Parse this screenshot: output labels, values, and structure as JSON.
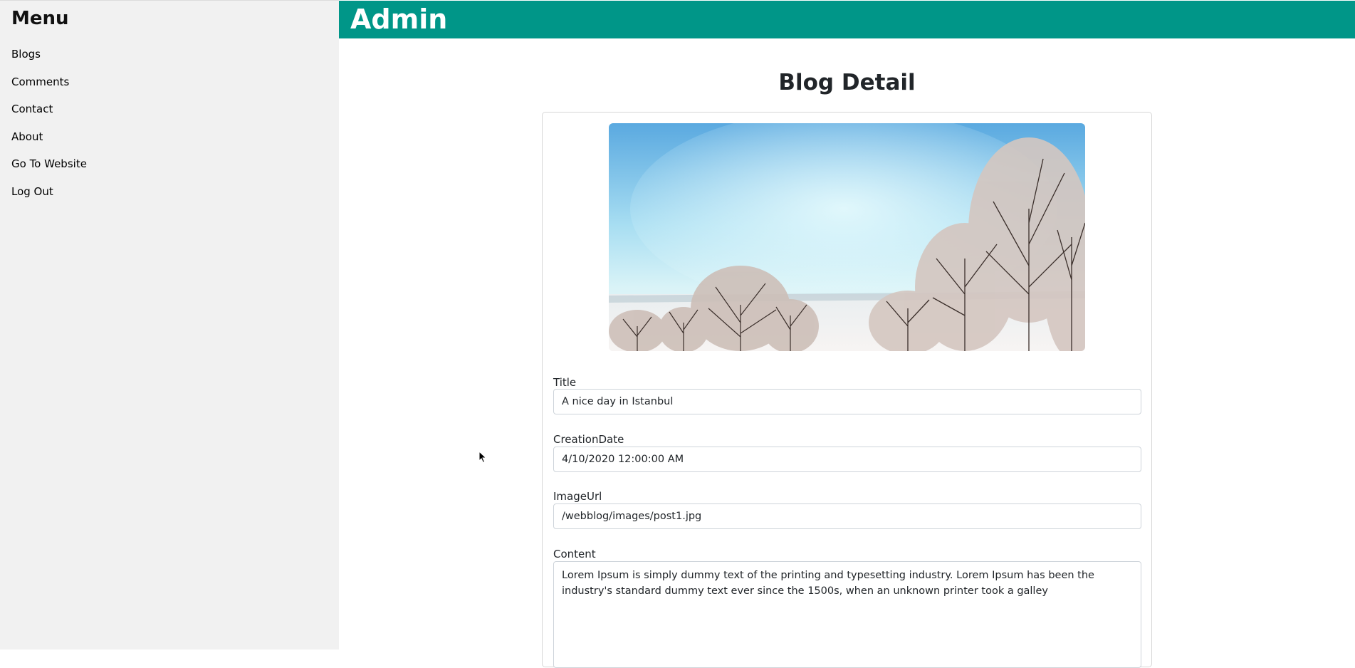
{
  "sidebar": {
    "title": "Menu",
    "items": [
      {
        "label": "Blogs"
      },
      {
        "label": "Comments"
      },
      {
        "label": "Contact"
      },
      {
        "label": "About"
      },
      {
        "label": "Go To Website"
      },
      {
        "label": "Log Out"
      }
    ]
  },
  "header": {
    "title": "Admin"
  },
  "main": {
    "page_title": "Blog Detail",
    "image": {
      "icon": "winter-trees-photo"
    },
    "fields": {
      "title": {
        "label": "Title",
        "value": "A nice day in Istanbul"
      },
      "creation_date": {
        "label": "CreationDate",
        "value": "4/10/2020 12:00:00 AM"
      },
      "image_url": {
        "label": "ImageUrl",
        "value": "/webblog/images/post1.jpg"
      },
      "content": {
        "label": "Content",
        "value": "Lorem Ipsum is simply dummy text of the printing and typesetting industry. Lorem Ipsum has been the industry's standard dummy text ever since the 1500s, when an unknown printer took a galley"
      }
    }
  },
  "colors": {
    "header_bg": "#009688",
    "sidebar_bg": "#f1f1f1",
    "border": "#ced4da"
  }
}
